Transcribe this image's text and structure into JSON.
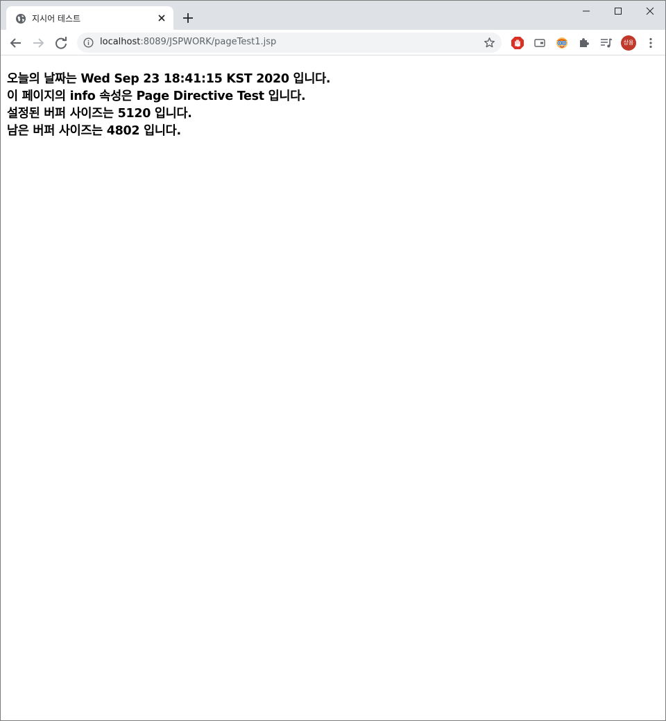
{
  "tab": {
    "title": "지시어 테스트",
    "favicon": "globe-icon"
  },
  "window_controls": [
    "minimize-icon",
    "maximize-icon",
    "close-icon"
  ],
  "toolbar": {
    "url_host": "localhost",
    "url_rest": ":8089/JSPWORK/pageTest1.jsp",
    "extensions": [
      "adblock-stop-hand-icon",
      "wallet-icon",
      "glasses-face-icon",
      "puzzle-extensions-icon",
      "media-playlist-icon"
    ],
    "profile_initials": "상용",
    "profile_color": "#c0392b"
  },
  "page": {
    "lines": [
      "오늘의 날짜는 Wed Sep 23 18:41:15 KST 2020 입니다.",
      "이 페이지의 info 속성은 Page Directive Test 입니다.",
      "설정된 버퍼 사이즈는 5120 입니다.",
      "남은 버퍼 사이즈는 4802 입니다."
    ]
  }
}
